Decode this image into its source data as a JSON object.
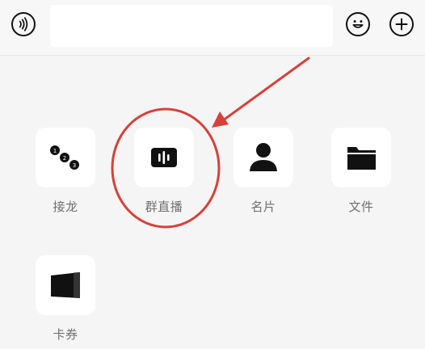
{
  "toolbar": {
    "voice_icon": "voice-icon",
    "emoji_icon": "emoji-icon",
    "plus_icon": "plus-icon",
    "input_value": ""
  },
  "panel": {
    "items": [
      {
        "label": "接龙",
        "icon": "relay-icon"
      },
      {
        "label": "群直播",
        "icon": "group-live-icon"
      },
      {
        "label": "名片",
        "icon": "contact-card-icon"
      },
      {
        "label": "文件",
        "icon": "folder-icon"
      },
      {
        "label": "卡券",
        "icon": "coupon-icon"
      }
    ]
  },
  "annotation": {
    "color": "#d8403a",
    "target": "群直播"
  }
}
